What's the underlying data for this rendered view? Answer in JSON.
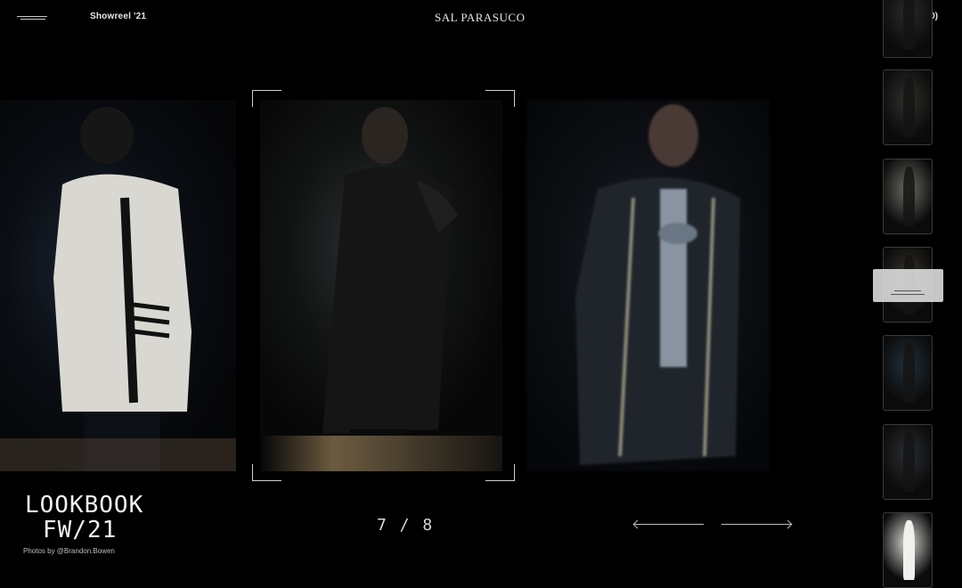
{
  "header": {
    "menu_icon": "hamburger-icon",
    "showreel_label": "Showreel '21",
    "brand": "SAL PARASUCO",
    "cart_label": "Cart (0)"
  },
  "lookbook": {
    "line1": "LOOKBOOK",
    "line2": "FW/21",
    "credit": "Photos by @Brandon.Bowen"
  },
  "slider": {
    "counter": "7 / 8",
    "prev_icon": "arrow-left-icon",
    "next_icon": "arrow-right-icon",
    "current": 7,
    "total": 8
  },
  "thumbnails": [
    {
      "tone": "#2b2a2a",
      "active": false
    },
    {
      "tone": "#33302c",
      "active": false
    },
    {
      "tone": "#6d6a63",
      "active": false
    },
    {
      "tone": "#3a342c",
      "active": true
    },
    {
      "tone": "#22303a",
      "active": false
    },
    {
      "tone": "#2a2e33",
      "active": false
    },
    {
      "tone": "#d8d6d2",
      "active": false
    }
  ]
}
